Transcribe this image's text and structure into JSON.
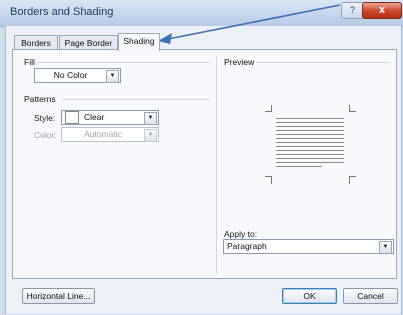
{
  "window": {
    "title": "Borders and Shading",
    "help_label": "?",
    "close_label": "x"
  },
  "tabs": [
    {
      "label": "Borders",
      "active": false
    },
    {
      "label": "Page Border",
      "active": false
    },
    {
      "label": "Shading",
      "active": true
    }
  ],
  "fill": {
    "header": "Fill",
    "value": "No Color"
  },
  "patterns": {
    "header": "Patterns",
    "style_label": "Style:",
    "style_value": "Clear",
    "color_label": "Color:",
    "color_value": "Automatic",
    "color_disabled": true
  },
  "preview": {
    "header": "Preview"
  },
  "apply_to": {
    "label": "Apply to:",
    "value": "Paragraph"
  },
  "buttons": {
    "horizontal_line": "Horizontal Line...",
    "ok": "OK",
    "cancel": "Cancel"
  },
  "colors": {
    "annotation_arrow": "#3f6fb5",
    "close_button": "#c9452a"
  }
}
